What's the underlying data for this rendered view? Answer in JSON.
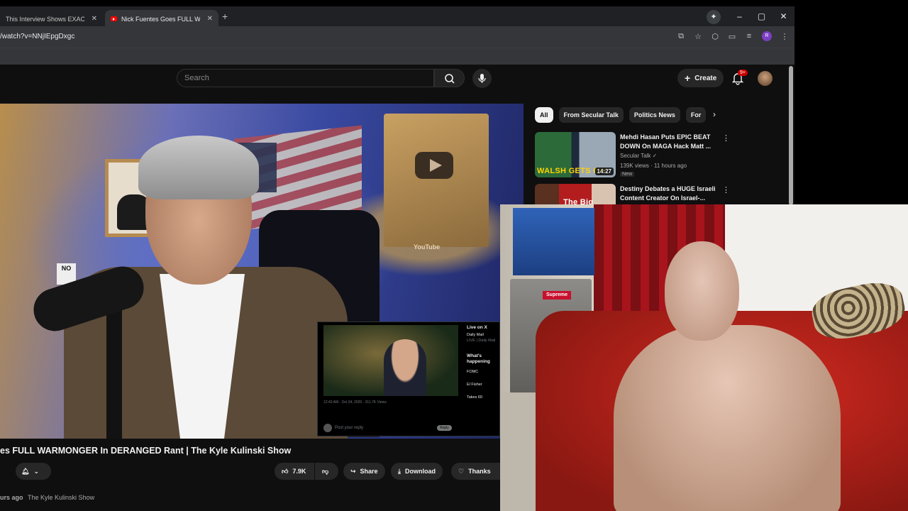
{
  "browser": {
    "tabs": [
      {
        "title": "This Interview Shows EXACTLY",
        "active": false
      },
      {
        "title": "Nick Fuentes Goes FULL WARM",
        "active": true
      }
    ],
    "url": "/watch?v=NNjIEpgDxgc",
    "profile_initial": "R"
  },
  "youtube": {
    "search_placeholder": "Search",
    "create_label": "Create",
    "notifications": "9+",
    "video_title": "es FULL WARMONGER In DERANGED Rant | The Kyle Kulinski Show",
    "likes": "7.9K",
    "share_label": "Share",
    "download_label": "Download",
    "thanks_label": "Thanks",
    "meta_time": "urs ago",
    "meta_channel": "The Kyle Kulinski Show",
    "video_overlay": {
      "sign_text": "NO",
      "plaque_text": "YouTube",
      "x_reply_placeholder": "Post your reply",
      "x_reply_button": "Reply",
      "x_meta": "12:43 AM · Oct 24, 2025 · 311.7K Views",
      "x_side": {
        "heading": "Live on X",
        "line1": "Daily Mail",
        "line2": "LIVE | Daily Mail",
        "section": "What's happening",
        "trend1": "FOMC",
        "trend2": "El Fisher",
        "trend3": "Takes 60"
      }
    },
    "chips": [
      "All",
      "From Secular Talk",
      "Politics News",
      "For"
    ],
    "recommendations": [
      {
        "title": "Mehdi Hasan Puts EPIC BEAT DOWN On MAGA Hack Matt ...",
        "channel": "Secular Talk",
        "stats": "139K views · 11 hours ago",
        "badge": "New",
        "duration": "14:27",
        "thumb_text": "WALSH GETS OW"
      },
      {
        "title": "Destiny Debates a HUGE Israeli Content Creator On Israel-...",
        "thumb_text": "The Big"
      }
    ]
  },
  "webcam": {
    "sticker_text": "Supreme"
  },
  "colors": {
    "yt_bg": "#0f0f0f",
    "chip_bg": "#272727",
    "brand_red": "#ff0000",
    "profile": "#7b3fc1"
  }
}
